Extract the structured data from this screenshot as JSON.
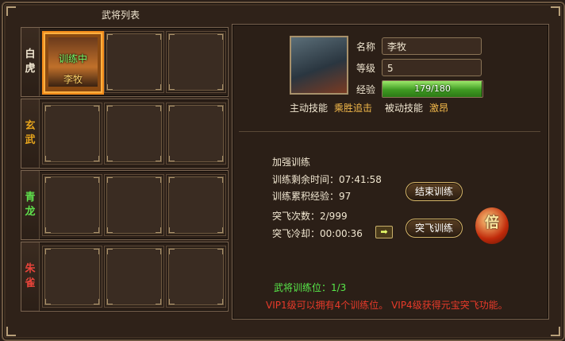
{
  "title": "武将列表",
  "groups": [
    {
      "label": "白\n虎",
      "color": "#f0e6d0"
    },
    {
      "label": "玄\n武",
      "color": "#e8a51c"
    },
    {
      "label": "青\n龙",
      "color": "#5fe04c"
    },
    {
      "label": "朱\n雀",
      "color": "#e8443a"
    }
  ],
  "active_slot": {
    "status": "训练中",
    "name": "李牧"
  },
  "hero": {
    "name_label": "名称",
    "name": "李牧",
    "level_label": "等级",
    "level": "5",
    "exp_label": "经验",
    "exp_text": "179/180",
    "exp_ratio": 0.994,
    "active_skill_label": "主动技能",
    "active_skill": "乘胜追击",
    "passive_skill_label": "被动技能",
    "passive_skill": "激昂"
  },
  "training": {
    "header": "加强训练",
    "remaining": "训练剩余时间：07:41:58",
    "accumulated": "训练累积经验：97",
    "end_button": "结束训练",
    "breakthrough_count": "突飞次数：2/999",
    "breakthrough_cooldown": "突飞冷却：00:00:36",
    "breakthrough_button": "突飞训练",
    "double_icon_text": "倍",
    "slots": "武将训练位：1/3",
    "vip_note": "VIP1级可以拥有4个训练位。 VIP4级获得元宝突飞功能。"
  }
}
